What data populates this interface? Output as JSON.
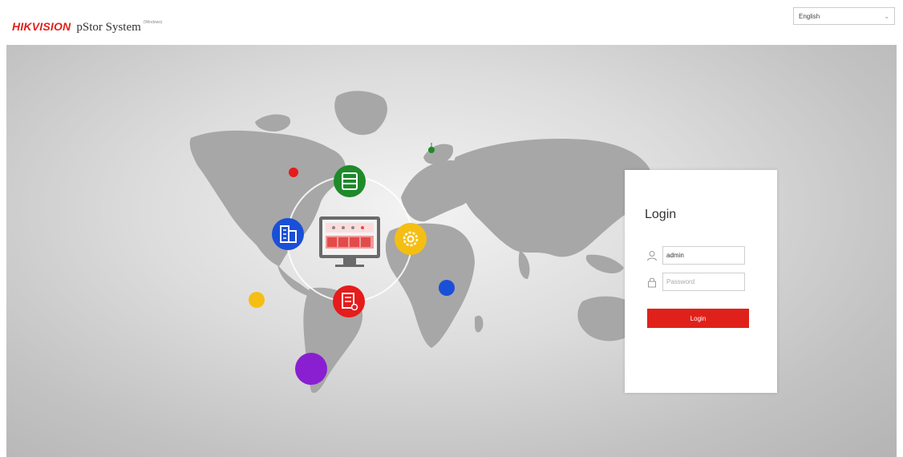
{
  "header": {
    "brand": "HIKVISION",
    "product": "pStor System",
    "edition": "(Windows)",
    "language": {
      "selected": "English",
      "icon": "chevron-down-icon"
    }
  },
  "illustration": {
    "center_icon": "monitor-icon",
    "nodes": [
      {
        "name": "storage-node",
        "icon": "database-icon",
        "color": "#1e8a2a"
      },
      {
        "name": "server-node",
        "icon": "building-icon",
        "color": "#1a4fd8"
      },
      {
        "name": "settings-node",
        "icon": "gear-icon",
        "color": "#f5be13"
      },
      {
        "name": "record-node",
        "icon": "document-icon",
        "color": "#e61b1b"
      }
    ],
    "dot_colors": {
      "red": "#e61b1b",
      "green": "#1e8a2a",
      "yellow": "#f5be13",
      "blue": "#1a4fd8",
      "purple": "#8a1fd1"
    }
  },
  "login": {
    "title": "Login",
    "username": {
      "value": "admin",
      "icon": "user-icon"
    },
    "password": {
      "placeholder": "Password",
      "icon": "lock-icon"
    },
    "submit_label": "Login",
    "accent": "#e0211b"
  }
}
